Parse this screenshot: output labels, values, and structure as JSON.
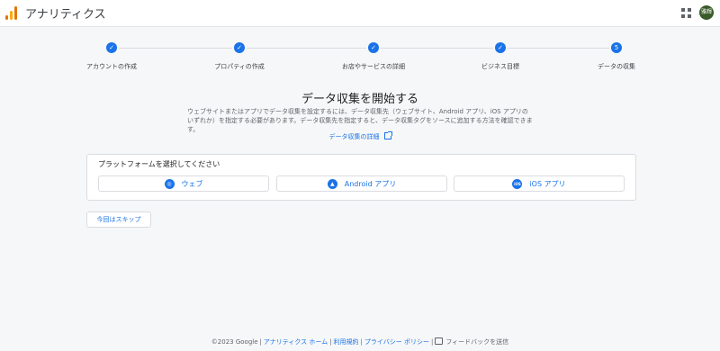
{
  "header": {
    "app_title": "アナリティクス",
    "avatar_text": "雅輝",
    "logo_icon": "analytics-bars-icon",
    "apps_icon": "apps-grid-icon"
  },
  "stepper": {
    "steps": [
      {
        "label": "アカウントの作成",
        "mark": "✓",
        "done": true
      },
      {
        "label": "プロパティの作成",
        "mark": "✓",
        "done": true
      },
      {
        "label": "お店やサービスの詳細",
        "mark": "✓",
        "done": true
      },
      {
        "label": "ビジネス目標",
        "mark": "✓",
        "done": true
      },
      {
        "label": "データの収集",
        "mark": "5",
        "done": false
      }
    ]
  },
  "main": {
    "title": "データ収集を開始する",
    "description": "ウェブサイトまたはアプリでデータ収集を設定するには、データ収集先（ウェブサイト、Android アプリ、iOS アプリのいずれか）を指定する必要があります。データ収集先を指定すると、データ収集タグをソースに追加する方法を確認できます。",
    "details_link": "データ収集の詳細"
  },
  "platform_card": {
    "title": "プラットフォームを選択してください",
    "buttons": [
      {
        "label": "ウェブ",
        "icon": "globe-icon",
        "glyph": "◎"
      },
      {
        "label": "Android アプリ",
        "icon": "android-icon",
        "glyph": "▲"
      },
      {
        "label": "iOS アプリ",
        "icon": "ios-icon",
        "glyph": "iOS"
      }
    ]
  },
  "skip_button": "今回はスキップ",
  "footer": {
    "copyright": "©2023 Google",
    "home_link": "アナリティクス ホーム",
    "terms_link": "利用規約",
    "privacy_link": "プライバシー ポリシー",
    "feedback_link": "フィードバックを送信"
  },
  "colors": {
    "accent": "#1a73e8",
    "logo_orange": "#e37400",
    "logo_yellow": "#f9ab00",
    "background": "#f6f7f8"
  }
}
